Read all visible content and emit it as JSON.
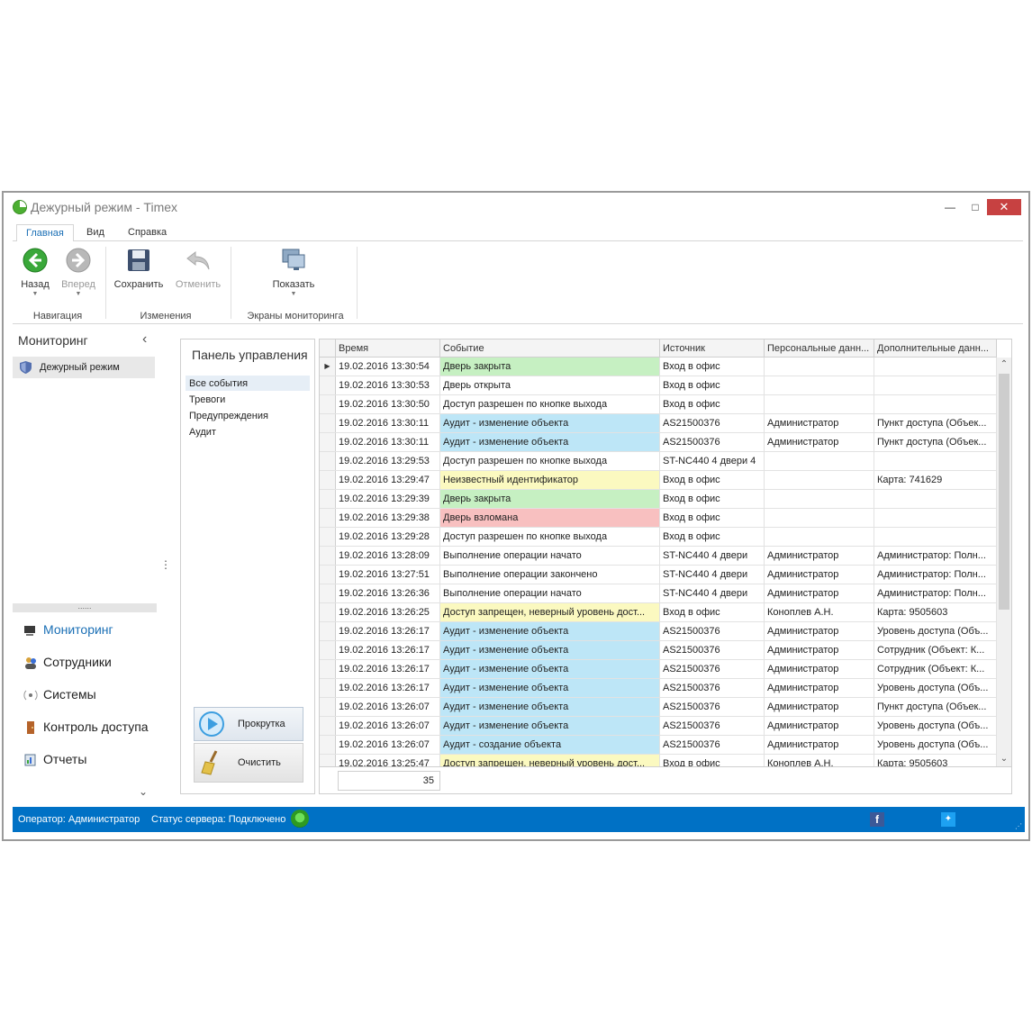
{
  "window": {
    "title": "Дежурный режим - Timex"
  },
  "ribbon": {
    "tabs": [
      "Главная",
      "Вид",
      "Справка"
    ],
    "buttons": {
      "back": "Назад",
      "forward": "Вперед",
      "save": "Сохранить",
      "undo": "Отменить",
      "show": "Показать"
    },
    "groups": {
      "navigation": "Навигация",
      "changes": "Изменения",
      "screens": "Экраны мониторинга"
    }
  },
  "left_pane": {
    "title": "Мониторинг",
    "selected_item": "Дежурный режим",
    "nav": [
      "Мониторинг",
      "Сотрудники",
      "Системы",
      "Контроль доступа",
      "Отчеты"
    ],
    "splitter_dots": "......"
  },
  "control_panel": {
    "title": "Панель управления",
    "filters": [
      "Все события",
      "Тревоги",
      "Предупреждения",
      "Аудит"
    ],
    "scroll_button": "Прокрутка",
    "clear_button": "Очистить"
  },
  "grid": {
    "columns": [
      "Время",
      "Событие",
      "Источник",
      "Персональные данн...",
      "Дополнительные данн..."
    ],
    "colors": {
      "green": "#c6f0c2",
      "blue": "#bde6f7",
      "yellow": "#fbf9c0",
      "red": "#f8c0c0"
    },
    "rows": [
      {
        "time": "19.02.2016 13:30:54",
        "event": "Дверь закрыта",
        "source": "Вход в офис",
        "personal": "",
        "extra": "",
        "color": "green"
      },
      {
        "time": "19.02.2016 13:30:53",
        "event": "Дверь открыта",
        "source": "Вход в офис",
        "personal": "",
        "extra": "",
        "color": ""
      },
      {
        "time": "19.02.2016 13:30:50",
        "event": "Доступ разрешен по кнопке выхода",
        "source": "Вход в офис",
        "personal": "",
        "extra": "",
        "color": ""
      },
      {
        "time": "19.02.2016 13:30:11",
        "event": "Аудит - изменение объекта",
        "source": "AS21500376",
        "personal": "Администратор",
        "extra": "Пункт доступа (Объек...",
        "color": "blue"
      },
      {
        "time": "19.02.2016 13:30:11",
        "event": "Аудит - изменение объекта",
        "source": "AS21500376",
        "personal": "Администратор",
        "extra": "Пункт доступа (Объек...",
        "color": "blue"
      },
      {
        "time": "19.02.2016 13:29:53",
        "event": "Доступ разрешен по кнопке выхода",
        "source": "ST-NC440 4 двери 4",
        "personal": "",
        "extra": "",
        "color": ""
      },
      {
        "time": "19.02.2016 13:29:47",
        "event": "Неизвестный идентификатор",
        "source": "Вход в офис",
        "personal": "",
        "extra": "Карта: 741629",
        "color": "yellow"
      },
      {
        "time": "19.02.2016 13:29:39",
        "event": "Дверь закрыта",
        "source": "Вход в офис",
        "personal": "",
        "extra": "",
        "color": "green"
      },
      {
        "time": "19.02.2016 13:29:38",
        "event": "Дверь взломана",
        "source": "Вход в офис",
        "personal": "",
        "extra": "",
        "color": "red"
      },
      {
        "time": "19.02.2016 13:29:28",
        "event": "Доступ разрешен по кнопке выхода",
        "source": "Вход в офис",
        "personal": "",
        "extra": "",
        "color": ""
      },
      {
        "time": "19.02.2016 13:28:09",
        "event": "Выполнение операции начато",
        "source": "ST-NC440 4 двери",
        "personal": "Администратор",
        "extra": "Администратор: Полн...",
        "color": ""
      },
      {
        "time": "19.02.2016 13:27:51",
        "event": "Выполнение операции закончено",
        "source": "ST-NC440 4 двери",
        "personal": "Администратор",
        "extra": "Администратор: Полн...",
        "color": ""
      },
      {
        "time": "19.02.2016 13:26:36",
        "event": "Выполнение операции начато",
        "source": "ST-NC440 4 двери",
        "personal": "Администратор",
        "extra": "Администратор: Полн...",
        "color": ""
      },
      {
        "time": "19.02.2016 13:26:25",
        "event": "Доступ запрещен, неверный уровень дост...",
        "source": "Вход в офис",
        "personal": "Коноплев А.Н.",
        "extra": "Карта: 9505603",
        "color": "yellow"
      },
      {
        "time": "19.02.2016 13:26:17",
        "event": "Аудит - изменение объекта",
        "source": "AS21500376",
        "personal": "Администратор",
        "extra": "Уровень доступа (Объ...",
        "color": "blue"
      },
      {
        "time": "19.02.2016 13:26:17",
        "event": "Аудит - изменение объекта",
        "source": "AS21500376",
        "personal": "Администратор",
        "extra": "Сотрудник (Объект: К...",
        "color": "blue"
      },
      {
        "time": "19.02.2016 13:26:17",
        "event": "Аудит - изменение объекта",
        "source": "AS21500376",
        "personal": "Администратор",
        "extra": "Сотрудник (Объект: К...",
        "color": "blue"
      },
      {
        "time": "19.02.2016 13:26:17",
        "event": "Аудит - изменение объекта",
        "source": "AS21500376",
        "personal": "Администратор",
        "extra": "Уровень доступа (Объ...",
        "color": "blue"
      },
      {
        "time": "19.02.2016 13:26:07",
        "event": "Аудит - изменение объекта",
        "source": "AS21500376",
        "personal": "Администратор",
        "extra": "Пункт доступа (Объек...",
        "color": "blue"
      },
      {
        "time": "19.02.2016 13:26:07",
        "event": "Аудит - изменение объекта",
        "source": "AS21500376",
        "personal": "Администратор",
        "extra": "Уровень доступа (Объ...",
        "color": "blue"
      },
      {
        "time": "19.02.2016 13:26:07",
        "event": "Аудит - создание объекта",
        "source": "AS21500376",
        "personal": "Администратор",
        "extra": "Уровень доступа (Объ...",
        "color": "blue"
      },
      {
        "time": "19.02.2016 13:25:47",
        "event": "Доступ запрещен, неверный уровень дост...",
        "source": "Вход в офис",
        "personal": "Коноплев А.Н.",
        "extra": "Карта: 9505603",
        "color": "yellow"
      }
    ],
    "count": "35"
  },
  "status_bar": {
    "operator": "Оператор: Администратор",
    "server": "Статус сервера: Подключено"
  }
}
